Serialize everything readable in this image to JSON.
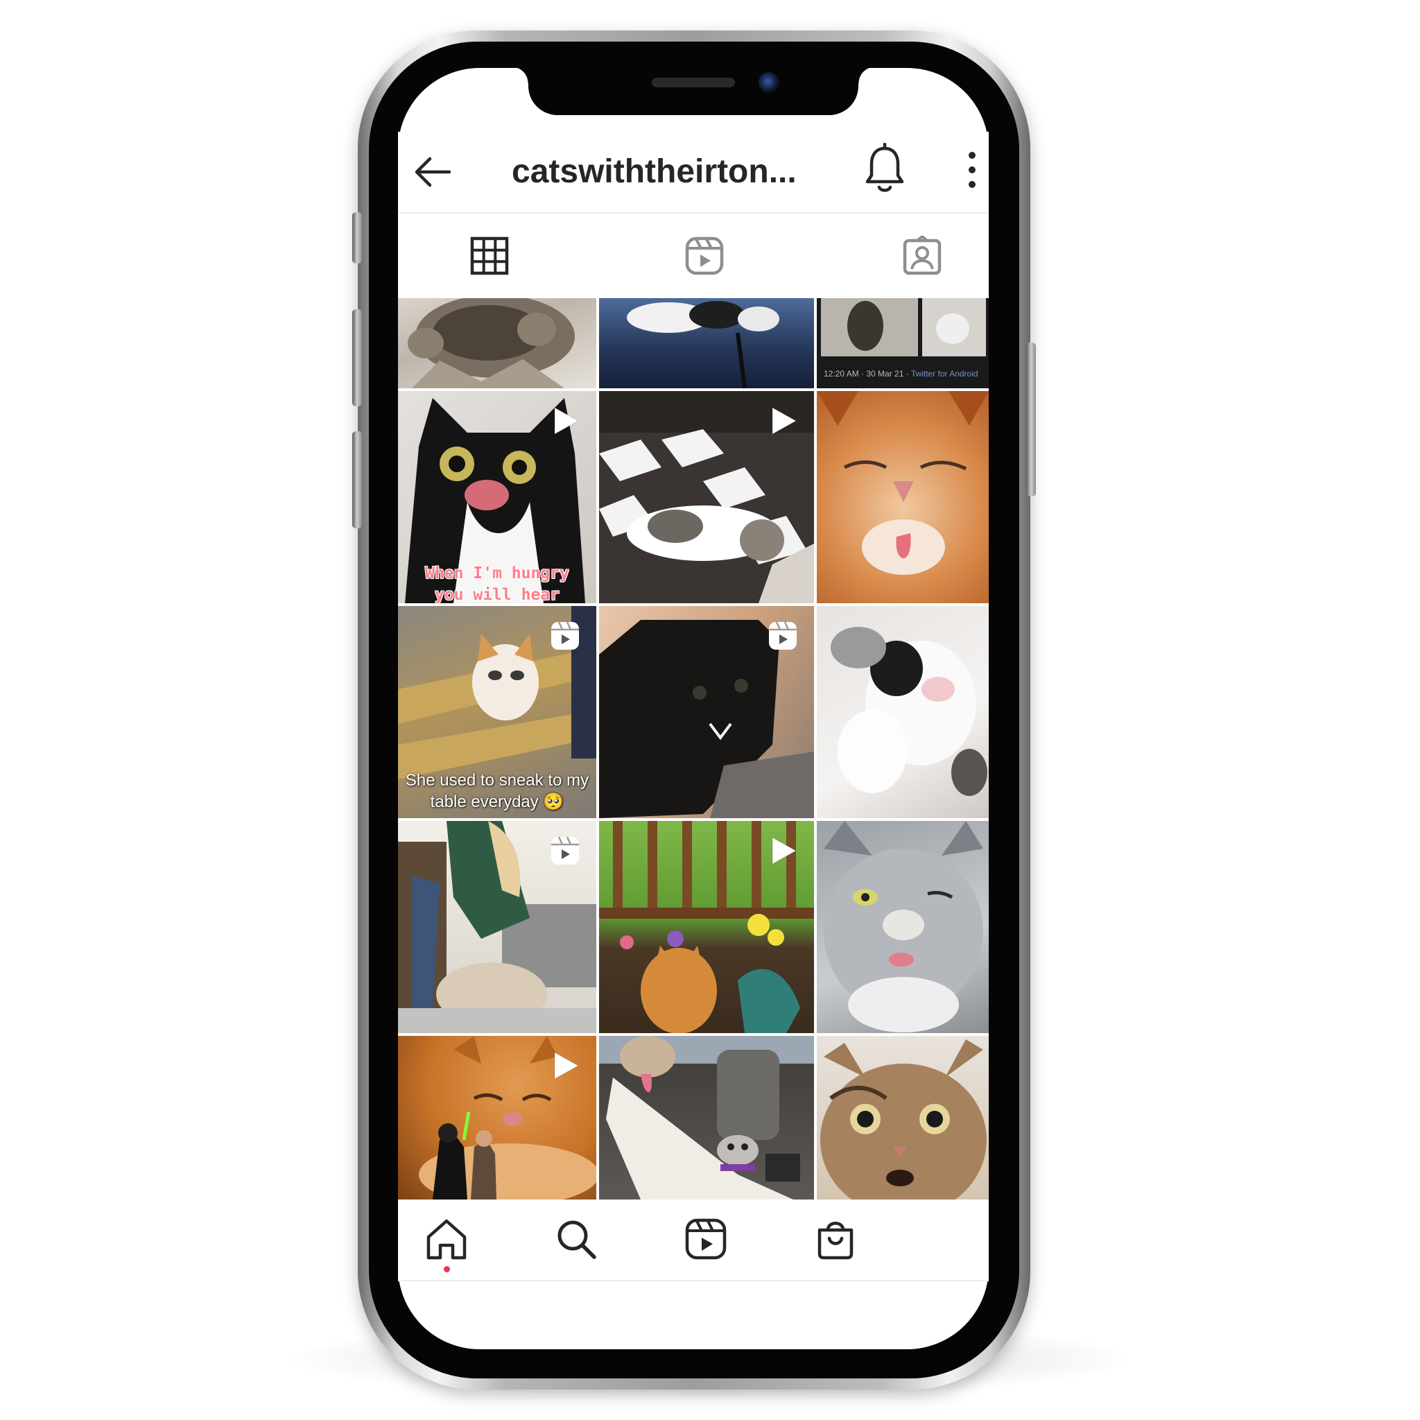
{
  "app": {
    "profile_title": "catswiththeirton...",
    "accent_color": "#e8364f"
  },
  "header": {
    "back_icon": "arrow-left-icon",
    "notifications_icon": "bell-icon",
    "more_icon": "vertical-dots-icon"
  },
  "tabs": [
    {
      "name": "posts",
      "icon": "grid-icon",
      "selected": true
    },
    {
      "name": "reels",
      "icon": "reels-icon",
      "selected": false
    },
    {
      "name": "tagged",
      "icon": "tagged-person-icon",
      "selected": false
    }
  ],
  "grid": {
    "posts": [
      {
        "id": 1,
        "type": "photo",
        "badge": null,
        "caption": ""
      },
      {
        "id": 2,
        "type": "photo",
        "badge": null,
        "caption": ""
      },
      {
        "id": 3,
        "type": "photo",
        "badge": null,
        "caption": "",
        "stamp_time": "12:20 AM · 30 Mar 21 ·",
        "stamp_source": "Twitter for Android"
      },
      {
        "id": 4,
        "type": "video",
        "badge": "play-icon",
        "caption_lines": [
          "When I'm hungry",
          "you will hear"
        ]
      },
      {
        "id": 5,
        "type": "video",
        "badge": "play-icon",
        "caption": ""
      },
      {
        "id": 6,
        "type": "photo",
        "badge": null,
        "caption": ""
      },
      {
        "id": 7,
        "type": "reel",
        "badge": "reels-icon",
        "caption_lines": [
          "She used to sneak to my",
          "table everyday 🥺"
        ]
      },
      {
        "id": 8,
        "type": "reel",
        "badge": "reels-icon",
        "caption": ""
      },
      {
        "id": 9,
        "type": "photo",
        "badge": null,
        "caption": ""
      },
      {
        "id": 10,
        "type": "reel",
        "badge": "reels-icon",
        "caption": ""
      },
      {
        "id": 11,
        "type": "video",
        "badge": "play-icon",
        "caption": ""
      },
      {
        "id": 12,
        "type": "photo",
        "badge": null,
        "caption": ""
      },
      {
        "id": 13,
        "type": "video",
        "badge": "play-icon",
        "caption": ""
      },
      {
        "id": 14,
        "type": "photo",
        "badge": null,
        "caption": ""
      },
      {
        "id": 15,
        "type": "photo",
        "badge": null,
        "caption": ""
      }
    ]
  },
  "bottom_nav": [
    {
      "name": "home",
      "icon": "home-icon",
      "active": true
    },
    {
      "name": "search",
      "icon": "search-icon",
      "active": false
    },
    {
      "name": "reels",
      "icon": "reels-icon",
      "active": false
    },
    {
      "name": "shop",
      "icon": "shop-bag-icon",
      "active": false
    }
  ]
}
